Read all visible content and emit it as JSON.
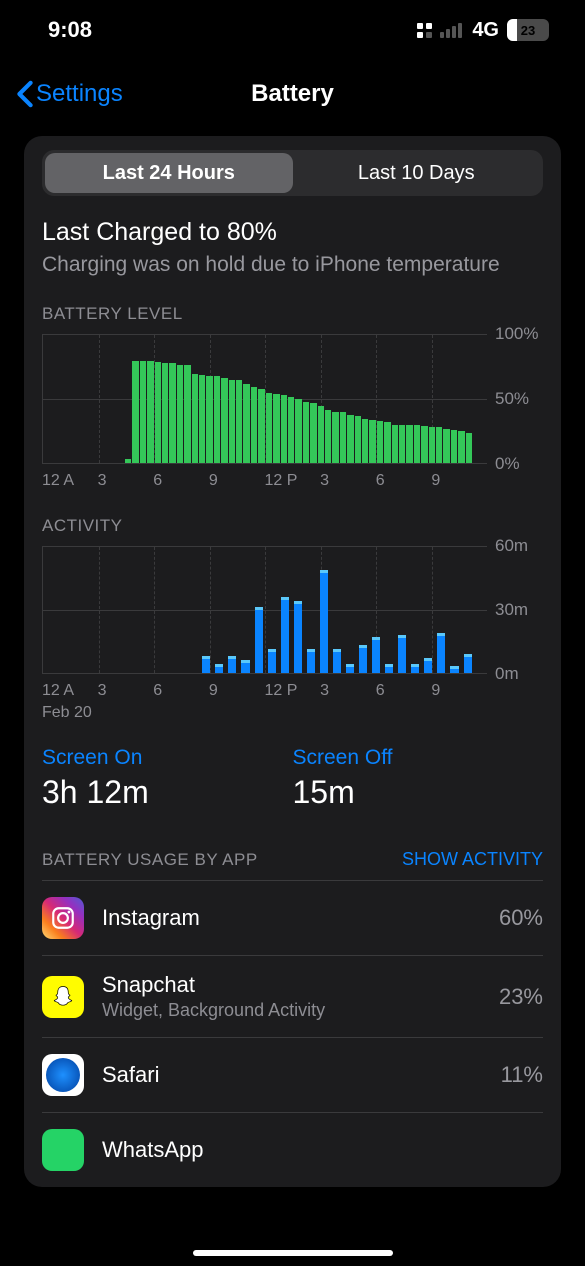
{
  "status": {
    "time": "9:08",
    "network": "4G",
    "battery_pct": "23",
    "battery_fill": 23
  },
  "nav": {
    "back": "Settings",
    "title": "Battery"
  },
  "tabs": {
    "a": "Last 24 Hours",
    "b": "Last 10 Days"
  },
  "charge": {
    "title": "Last Charged to 80%",
    "sub": "Charging was on hold due to iPhone temperature"
  },
  "battery_level": {
    "label": "BATTERY LEVEL",
    "y": {
      "top": "100%",
      "mid": "50%",
      "bot": "0%"
    },
    "x": [
      "12 A",
      "3",
      "6",
      "9",
      "12 P",
      "3",
      "6",
      "9"
    ]
  },
  "activity": {
    "label": "ACTIVITY",
    "y": {
      "top": "60m",
      "mid": "30m",
      "bot": "0m"
    },
    "x": [
      "12 A",
      "3",
      "6",
      "9",
      "12 P",
      "3",
      "6",
      "9"
    ],
    "date": "Feb 20"
  },
  "usage": {
    "on_label": "Screen On",
    "on_val": "3h 12m",
    "off_label": "Screen Off",
    "off_val": "15m"
  },
  "list": {
    "header": "BATTERY USAGE BY APP",
    "toggle": "SHOW ACTIVITY",
    "apps": [
      {
        "name": "Instagram",
        "sub": "",
        "pct": "60%"
      },
      {
        "name": "Snapchat",
        "sub": "Widget, Background Activity",
        "pct": "23%"
      },
      {
        "name": "Safari",
        "sub": "",
        "pct": "11%"
      },
      {
        "name": "WhatsApp",
        "sub": "",
        "pct": ""
      }
    ]
  },
  "chart_data": [
    {
      "type": "bar",
      "title": "Battery Level",
      "ylabel": "%",
      "ylim": [
        0,
        100
      ],
      "x_ticks": [
        "12 A",
        "3",
        "6",
        "9",
        "12 P",
        "3",
        "6",
        "9"
      ],
      "values": [
        0,
        0,
        0,
        0,
        0,
        0,
        0,
        0,
        0,
        0,
        0,
        3,
        80,
        80,
        80,
        79,
        78,
        78,
        77,
        77,
        70,
        69,
        68,
        68,
        67,
        65,
        65,
        62,
        60,
        58,
        55,
        54,
        53,
        52,
        50,
        48,
        47,
        45,
        42,
        40,
        40,
        38,
        37,
        35,
        34,
        33,
        32,
        30,
        30,
        30,
        30,
        29,
        28,
        28,
        27,
        26,
        25,
        24,
        0,
        0
      ]
    },
    {
      "type": "bar",
      "title": "Activity",
      "ylabel": "minutes",
      "ylim": [
        0,
        60
      ],
      "x_ticks": [
        "12 A",
        "3",
        "6",
        "9",
        "12 P",
        "3",
        "6",
        "9"
      ],
      "date": "Feb 20",
      "values": [
        0,
        0,
        0,
        0,
        0,
        0,
        0,
        0,
        0,
        0,
        0,
        0,
        7,
        3,
        7,
        5,
        30,
        10,
        35,
        33,
        10,
        48,
        10,
        3,
        12,
        16,
        3,
        17,
        3,
        6,
        18,
        2,
        8,
        0
      ],
      "series_colors": {
        "screen_on": "#0a84ff",
        "screen_off": "#5ac8fa"
      }
    }
  ]
}
